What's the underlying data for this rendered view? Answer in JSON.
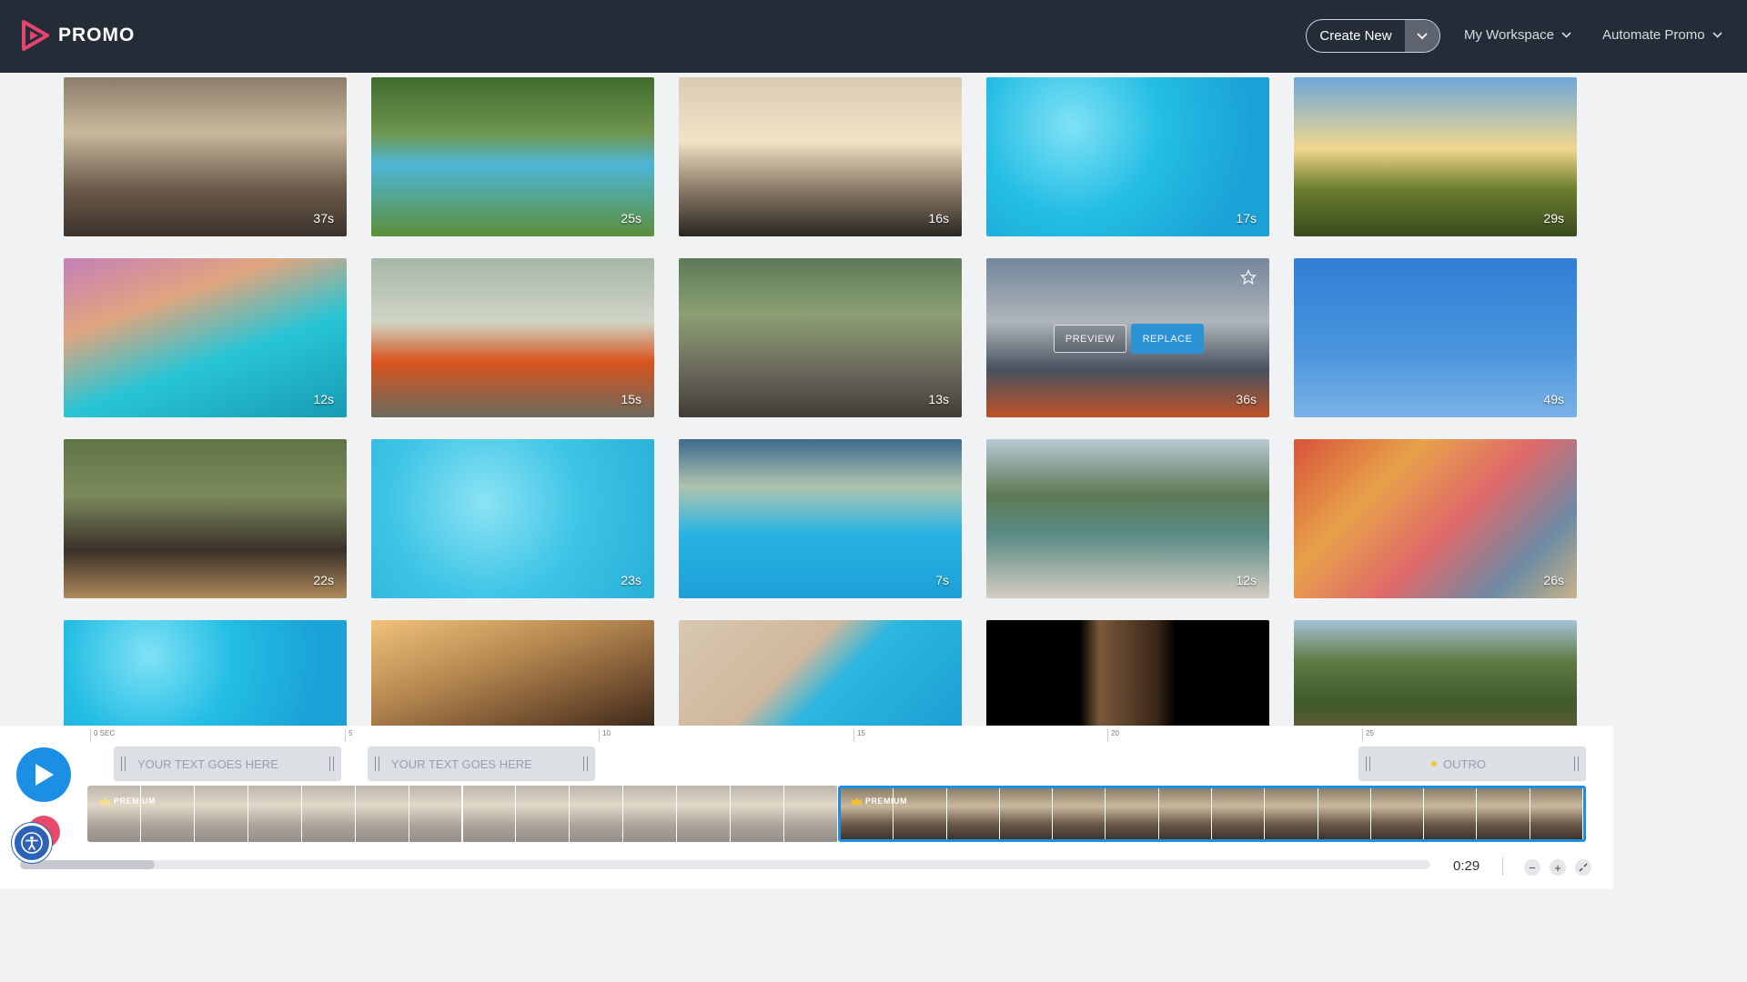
{
  "header": {
    "brand": "PROMO",
    "create_new": "Create New",
    "nav": [
      {
        "label": "My Workspace"
      },
      {
        "label": "Automate Promo"
      }
    ]
  },
  "grid": {
    "thumbs": [
      {
        "duration": "37s",
        "scene": "festival crowd"
      },
      {
        "duration": "25s",
        "scene": "backyard pool"
      },
      {
        "duration": "16s",
        "scene": "boat sunset"
      },
      {
        "duration": "17s",
        "scene": "pool water"
      },
      {
        "duration": "29s",
        "scene": "meadow sunset"
      },
      {
        "duration": "12s",
        "scene": "paddleboard"
      },
      {
        "duration": "15s",
        "scene": "car beach"
      },
      {
        "duration": "13s",
        "scene": "house party"
      },
      {
        "duration": "36s",
        "scene": "kayak paddle"
      },
      {
        "duration": "49s",
        "scene": "blue sky clouds"
      },
      {
        "duration": "22s",
        "scene": "porch couple"
      },
      {
        "duration": "23s",
        "scene": "pool swimmers"
      },
      {
        "duration": "7s",
        "scene": "pool party"
      },
      {
        "duration": "12s",
        "scene": "mountain lake"
      },
      {
        "duration": "26s",
        "scene": "colorful village"
      },
      {
        "duration": "",
        "scene": "pool water"
      },
      {
        "duration": "",
        "scene": "festival dancer"
      },
      {
        "duration": "",
        "scene": "sunglasses pool"
      },
      {
        "duration": "",
        "scene": "concert hands"
      },
      {
        "duration": "",
        "scene": "forest trail"
      }
    ],
    "hover_actions": {
      "preview": "PREVIEW",
      "replace": "REPLACE"
    }
  },
  "timeline": {
    "ruler": [
      "0 SEC",
      "5",
      "10",
      "15",
      "20",
      "25"
    ],
    "text_clips": [
      "YOUR TEXT GOES HERE",
      "YOUR TEXT GOES HERE"
    ],
    "outro": "OUTRO",
    "premium": "PREMIUM",
    "time": "0:29"
  }
}
